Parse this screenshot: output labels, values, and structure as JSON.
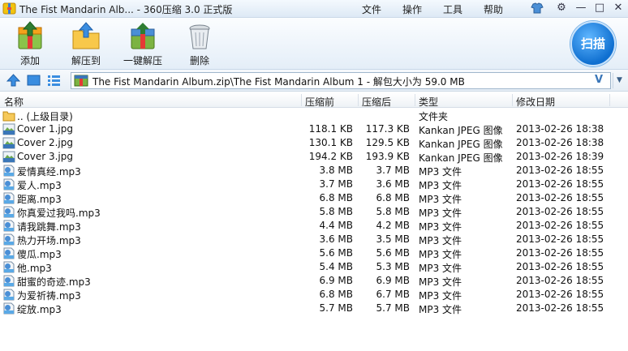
{
  "window": {
    "title": "The Fist Mandarin Alb... - 360压缩 3.0 正式版",
    "menu": [
      "文件",
      "操作",
      "工具",
      "帮助"
    ]
  },
  "toolbar": {
    "add": "添加",
    "extract_to": "解压到",
    "one_click_extract": "一键解压",
    "delete": "删除",
    "scan": "扫描"
  },
  "address": {
    "path": "The Fist Mandarin Album.zip\\The Fist Mandarin Album 1 - 解包大小为 59.0 MB",
    "v_label": "V"
  },
  "columns": {
    "name": "名称",
    "compressed": "压缩前",
    "after": "压缩后",
    "type": "类型",
    "modified": "修改日期"
  },
  "parent_row": {
    "name": ".. (上级目录)",
    "type": "文件夹"
  },
  "files": [
    {
      "icon": "jpg",
      "name": "Cover 1.jpg",
      "before": "118.1 KB",
      "after": "117.3 KB",
      "type": "Kankan JPEG 图像",
      "date": "2013-02-26 18:38"
    },
    {
      "icon": "jpg",
      "name": "Cover 2.jpg",
      "before": "130.1 KB",
      "after": "129.5 KB",
      "type": "Kankan JPEG 图像",
      "date": "2013-02-26 18:38"
    },
    {
      "icon": "jpg",
      "name": "Cover 3.jpg",
      "before": "194.2 KB",
      "after": "193.9 KB",
      "type": "Kankan JPEG 图像",
      "date": "2013-02-26 18:39"
    },
    {
      "icon": "mp3",
      "name": "爱情真经.mp3",
      "before": "3.8 MB",
      "after": "3.7 MB",
      "type": "MP3 文件",
      "date": "2013-02-26 18:55"
    },
    {
      "icon": "mp3",
      "name": "爱人.mp3",
      "before": "3.7 MB",
      "after": "3.6 MB",
      "type": "MP3 文件",
      "date": "2013-02-26 18:55"
    },
    {
      "icon": "mp3",
      "name": "距离.mp3",
      "before": "6.8 MB",
      "after": "6.8 MB",
      "type": "MP3 文件",
      "date": "2013-02-26 18:55"
    },
    {
      "icon": "mp3",
      "name": "你真爱过我吗.mp3",
      "before": "5.8 MB",
      "after": "5.8 MB",
      "type": "MP3 文件",
      "date": "2013-02-26 18:55"
    },
    {
      "icon": "mp3",
      "name": "请我跳舞.mp3",
      "before": "4.4 MB",
      "after": "4.2 MB",
      "type": "MP3 文件",
      "date": "2013-02-26 18:55"
    },
    {
      "icon": "mp3",
      "name": "热力开场.mp3",
      "before": "3.6 MB",
      "after": "3.5 MB",
      "type": "MP3 文件",
      "date": "2013-02-26 18:55"
    },
    {
      "icon": "mp3",
      "name": "傻瓜.mp3",
      "before": "5.6 MB",
      "after": "5.6 MB",
      "type": "MP3 文件",
      "date": "2013-02-26 18:55"
    },
    {
      "icon": "mp3",
      "name": "他.mp3",
      "before": "5.4 MB",
      "after": "5.3 MB",
      "type": "MP3 文件",
      "date": "2013-02-26 18:55"
    },
    {
      "icon": "mp3",
      "name": "甜蜜的奇迹.mp3",
      "before": "6.9 MB",
      "after": "6.9 MB",
      "type": "MP3 文件",
      "date": "2013-02-26 18:55"
    },
    {
      "icon": "mp3",
      "name": "为爱祈祷.mp3",
      "before": "6.8 MB",
      "after": "6.7 MB",
      "type": "MP3 文件",
      "date": "2013-02-26 18:55"
    },
    {
      "icon": "mp3",
      "name": "绽放.mp3",
      "before": "5.7 MB",
      "after": "5.7 MB",
      "type": "MP3 文件",
      "date": "2013-02-26 18:55"
    }
  ]
}
